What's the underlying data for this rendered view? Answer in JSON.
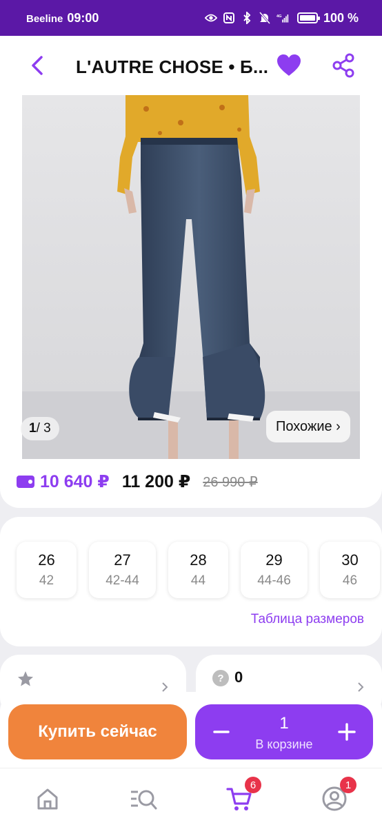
{
  "status_bar": {
    "carrier": "Beeline",
    "time": "09:00",
    "battery": "100 %",
    "network": "4G"
  },
  "header": {
    "title": "L'AUTRE CHOSE • Б..."
  },
  "gallery": {
    "current": "1",
    "total": "/ 3",
    "similar_label": "Похожие ›"
  },
  "prices": {
    "card_price": "10 640 ₽",
    "price": "11 200 ₽",
    "old_price": "26 990 ₽"
  },
  "sizes": [
    {
      "main": "26",
      "sub": "42"
    },
    {
      "main": "27",
      "sub": "42-44"
    },
    {
      "main": "28",
      "sub": "44"
    },
    {
      "main": "29",
      "sub": "44-46"
    },
    {
      "main": "30",
      "sub": "46"
    }
  ],
  "size_table_label": "Таблица размеров",
  "questions_count": "0",
  "action_bar": {
    "buy_now": "Купить сейчас",
    "quantity": "1",
    "in_cart": "В корзине"
  },
  "nav": {
    "cart_badge": "6",
    "profile_badge": "1"
  },
  "colors": {
    "brand_purple": "#8d3df0",
    "status_bar": "#5b18a6",
    "buy_orange": "#f0843c",
    "badge_red": "#e8334a"
  }
}
